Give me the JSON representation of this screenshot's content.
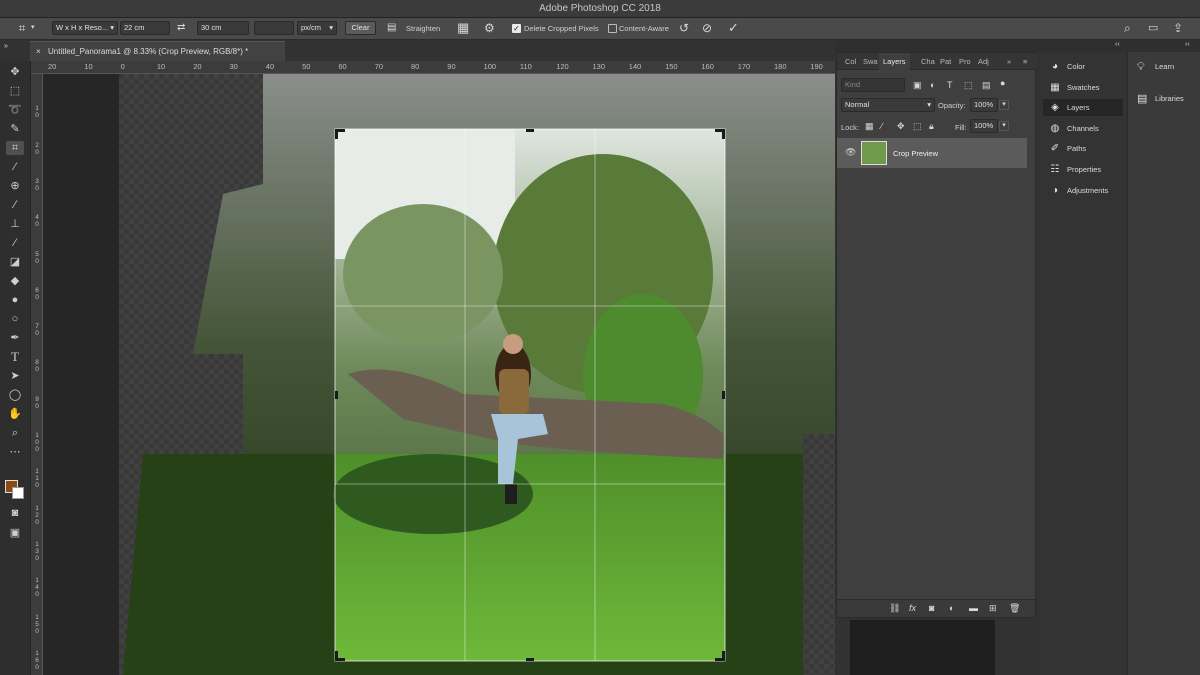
{
  "app": {
    "title": "Adobe Photoshop CC 2018"
  },
  "options": {
    "ratio_preset": "W x H x Reso...",
    "width": "22 cm",
    "height": "30 cm",
    "resolution": "",
    "units": "px/cm",
    "clear": "Clear",
    "straighten": "Straighten",
    "delete_cropped": "Delete Cropped Pixels",
    "content_aware": "Content-Aware"
  },
  "document": {
    "tab_title": "Untitled_Panorama1 @ 8.33% (Crop Preview, RGB/8*) *"
  },
  "ruler": {
    "h_ticks": [
      "20",
      "10",
      "0",
      "10",
      "20",
      "30",
      "40",
      "50",
      "60",
      "70",
      "80",
      "90",
      "100",
      "110",
      "120",
      "130",
      "140",
      "150",
      "160",
      "170",
      "180",
      "190"
    ],
    "v_ticks": [
      "0",
      "1 0",
      "2 0",
      "3 0",
      "4 0",
      "5 0",
      "6 0",
      "7 0",
      "8 0",
      "9 0",
      "1 0 0",
      "1 1 0",
      "1 2 0",
      "1 3 0",
      "1 4 0",
      "1 5 0",
      "1 6 0"
    ]
  },
  "layers_panel": {
    "tabs": [
      "Col",
      "Swa",
      "Layers",
      "Cha",
      "Pat",
      "Pro",
      "Adj"
    ],
    "kind_placeholder": "Kind",
    "blend_mode": "Normal",
    "opacity_label": "Opacity:",
    "opacity_value": "100%",
    "lock_label": "Lock:",
    "fill_label": "Fill:",
    "fill_value": "100%",
    "layers": [
      {
        "name": "Crop Preview"
      }
    ]
  },
  "side_panels": [
    {
      "label": "Color",
      "icon": "color-icon"
    },
    {
      "label": "Swatches",
      "icon": "swatches-icon"
    },
    {
      "label": "Layers",
      "icon": "layers-icon"
    },
    {
      "label": "Channels",
      "icon": "channels-icon"
    },
    {
      "label": "Paths",
      "icon": "paths-icon"
    },
    {
      "label": "Properties",
      "icon": "properties-icon"
    },
    {
      "label": "Adjustments",
      "icon": "adjustments-icon"
    }
  ],
  "right_panels": [
    {
      "label": "Learn",
      "icon": "lightbulb-icon"
    },
    {
      "label": "Libraries",
      "icon": "libraries-icon"
    }
  ],
  "colors": {
    "foreground": "#8a4b14",
    "background": "#ffffff"
  }
}
